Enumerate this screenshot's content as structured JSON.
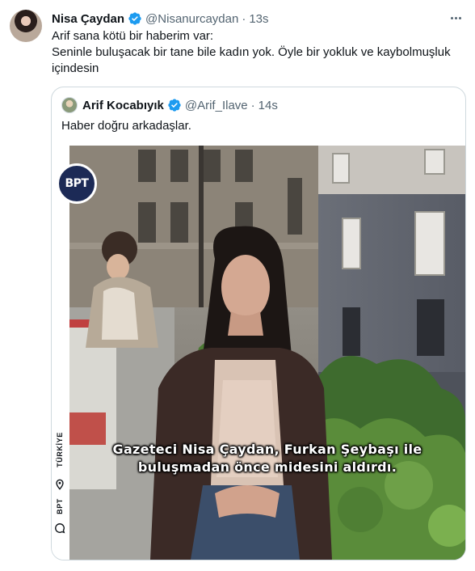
{
  "tweet": {
    "author_name": "Nisa Çaydan",
    "handle": "@Nisanurcaydan",
    "separator": "·",
    "time": "13s",
    "lines": [
      "Arif sana kötü bir haberim var:",
      "Seninle buluşacak bir tane bile kadın yok. Öyle bir yokluk ve kaybolmuşluk",
      "içindesin"
    ]
  },
  "quoted_tweet": {
    "author_name": "Arif Kocabıyık",
    "handle": "@Arif_Ilave",
    "separator": "·",
    "time": "14s",
    "text": "Haber doğru arkadaşlar.",
    "media": {
      "logo_text": "BPT",
      "side_labels": [
        "TÜRKİYE",
        "BPT"
      ],
      "caption_lines": [
        "Gazeteci Nisa Çaydan, Furkan Şeybaşı ile",
        "buluşmadan önce midesini aldırdı."
      ]
    }
  },
  "icons": {
    "verified": "verified-badge-icon",
    "more": "more-options-icon",
    "location": "location-pin-icon",
    "chat": "chat-bubble-icon"
  },
  "colors": {
    "verified": "#1d9bf0",
    "secondary_text": "#536471",
    "border": "#cfd9de",
    "badge_bg": "#1c2a56"
  }
}
